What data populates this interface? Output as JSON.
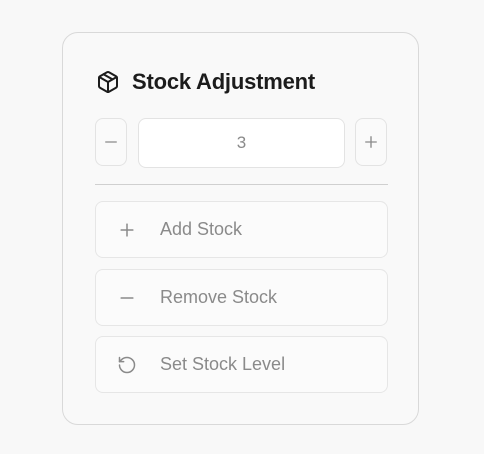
{
  "card": {
    "title": "Stock Adjustment",
    "title_icon": "package-icon"
  },
  "stepper": {
    "value": "3",
    "decrement_icon": "minus-icon",
    "increment_icon": "plus-icon"
  },
  "actions": [
    {
      "label": "Add Stock",
      "icon": "plus-icon"
    },
    {
      "label": "Remove Stock",
      "icon": "minus-icon"
    },
    {
      "label": "Set Stock Level",
      "icon": "rotate-ccw-icon"
    }
  ],
  "colors": {
    "background": "#f8f8f8",
    "card_border": "#d9d9d9",
    "title_text": "#1c1c1c",
    "muted_text": "#8a8a8a"
  }
}
